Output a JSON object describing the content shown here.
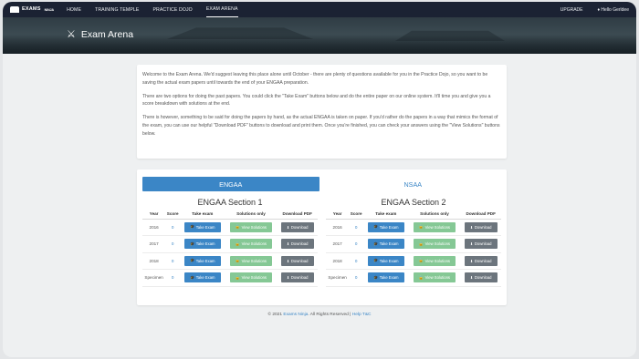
{
  "nav": {
    "brand": "EXAMS",
    "brand_sub": "NINJA",
    "items": [
      {
        "label": "HOME"
      },
      {
        "label": "TRAINING TEMPLE"
      },
      {
        "label": "PRACTICE DOJO"
      },
      {
        "label": "EXAM ARENA"
      }
    ],
    "active_index": 3,
    "upgrade_label": "UPGRADE",
    "user_label": "♦ Hello Gerldee"
  },
  "hero": {
    "icon": "crossed-swords-icon",
    "title": "Exam Arena"
  },
  "intro": {
    "p1": "Welcome to the Exam Arena. We'd suggest leaving this place alone until October - there are plenty of questions available for you in the Practice Dojo, so you want to be saving the actual exam papers until towards the end of your ENGAA preparation.",
    "p2": "There are two options for doing the past papers. You could click the \"Take Exam\" buttons below and do the entire paper on our online system. It'll time you and give you a score breakdown with solutions at the end.",
    "p3": "There is however, something to be said for doing the papers by hand, as the actual ENGAA is taken on paper. If you'd rather do the papers in a way that mimics the format of the exam, you can use our helpful \"Download PDF\" buttons to download and print them. Once you're finished, you can check your answers using the \"View Solutions\" buttons below."
  },
  "tabs": [
    {
      "label": "ENGAA",
      "active": true
    },
    {
      "label": "NSAA",
      "active": false
    }
  ],
  "table_headers": [
    "Year",
    "Score",
    "Take exam",
    "Solutions only",
    "Download PDF"
  ],
  "buttons": {
    "take": "Take Exam",
    "solutions": "View Solutions",
    "download": "Download"
  },
  "sections": [
    {
      "title": "ENGAA Section 1",
      "rows": [
        {
          "year": "2016",
          "score": "0"
        },
        {
          "year": "2017",
          "score": "0"
        },
        {
          "year": "2018",
          "score": "0"
        },
        {
          "year": "Specimen",
          "score": "0"
        }
      ]
    },
    {
      "title": "ENGAA Section 2",
      "rows": [
        {
          "year": "2016",
          "score": "0"
        },
        {
          "year": "2017",
          "score": "0"
        },
        {
          "year": "2018",
          "score": "0"
        },
        {
          "year": "Specimen",
          "score": "0"
        }
      ]
    }
  ],
  "footer": {
    "prefix": "© 2021",
    "brand_link": "Exams Ninja",
    "rights": ". All Rights Reserved |",
    "help_link": "Help",
    "tc_link": "T&C"
  },
  "colors": {
    "nav_bg": "#1b2233",
    "accent": "#3b86c6",
    "solutions": "#85c895",
    "download": "#6c757d"
  }
}
